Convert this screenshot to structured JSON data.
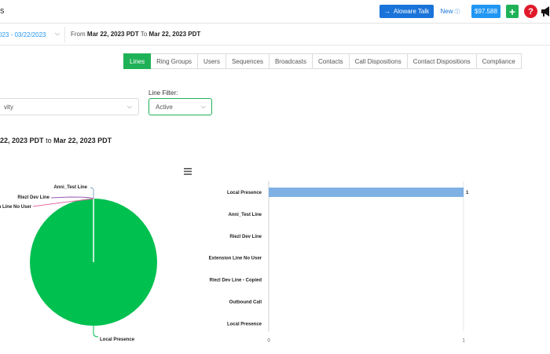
{
  "header": {
    "title_fragment": "s",
    "aloware_talk_label": "Aloware Talk",
    "new_label": "New",
    "balance": "$97.588"
  },
  "date_filter": {
    "picker_value": "023 - 03/22/2023",
    "from_word": "From",
    "from_date": "Mar 22, 2023 PDT",
    "to_word": "To",
    "to_date": "Mar 22, 2023 PDT"
  },
  "tabs": [
    {
      "label": "Lines",
      "active": true
    },
    {
      "label": "Ring Groups",
      "active": false
    },
    {
      "label": "Users",
      "active": false
    },
    {
      "label": "Sequences",
      "active": false
    },
    {
      "label": "Broadcasts",
      "active": false
    },
    {
      "label": "Contacts",
      "active": false
    },
    {
      "label": "Call Dispositions",
      "active": false
    },
    {
      "label": "Contact Dispositions",
      "active": false
    },
    {
      "label": "Compliance",
      "active": false
    }
  ],
  "filters": {
    "left_value": "vity",
    "line_filter_label": "Line Filter:",
    "line_filter_value": "Active"
  },
  "report_range": {
    "start": " 22, 2023 PDT",
    "to_word": "to",
    "end": "Mar 22, 2023 PDT"
  },
  "colors": {
    "green": "#1fb157",
    "blue": "#1a73d9",
    "bar": "#7fb0e3",
    "red": "#e0192a"
  },
  "chart_data": [
    {
      "type": "pie",
      "labels": [
        "Local Presence",
        "Anni_Test Line",
        "Riezl Dev Line",
        "Extension Line No User"
      ],
      "visible_labels": [
        "Local Presence",
        "Anni_Test Line",
        "Riezl Dev Line",
        "nsion Line No User"
      ],
      "values": [
        1,
        0,
        0,
        0
      ],
      "colors": [
        "#00c050",
        "#8aa6c8",
        "#9b59b6",
        "#e66aa0"
      ]
    },
    {
      "type": "bar",
      "orientation": "horizontal",
      "categories": [
        "Local Presence",
        "Anni_Test Line",
        "Riezl Dev Line",
        "Extension Line No User",
        "Riezl Dev Line - Copied",
        "Outbound Call",
        "Local Presence"
      ],
      "values": [
        1,
        0,
        0,
        0,
        0,
        0,
        0
      ],
      "data_labels": [
        "1"
      ],
      "xlim": [
        0,
        1
      ],
      "xticks": [
        "0",
        "1"
      ]
    }
  ]
}
